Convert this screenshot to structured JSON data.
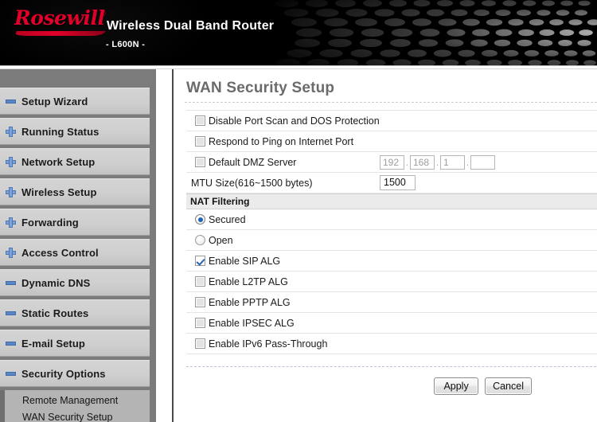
{
  "header": {
    "brand": "Rosewill",
    "registered_mark": "®",
    "product_title": "Wireless Dual Band Router",
    "model": "- L600N -"
  },
  "sidebar": {
    "items": [
      {
        "label": "Setup Wizard",
        "icon": "minus-icon"
      },
      {
        "label": "Running Status",
        "icon": "plus-icon"
      },
      {
        "label": "Network Setup",
        "icon": "plus-icon"
      },
      {
        "label": "Wireless Setup",
        "icon": "plus-icon"
      },
      {
        "label": "Forwarding",
        "icon": "plus-icon"
      },
      {
        "label": "Access Control",
        "icon": "plus-icon"
      },
      {
        "label": "Dynamic DNS",
        "icon": "minus-icon"
      },
      {
        "label": "Static Routes",
        "icon": "minus-icon"
      },
      {
        "label": "E-mail Setup",
        "icon": "minus-icon"
      },
      {
        "label": "Security Options",
        "icon": "minus-icon"
      }
    ],
    "subitems": [
      {
        "label": "Remote Management"
      },
      {
        "label": "WAN Security Setup"
      }
    ]
  },
  "main": {
    "title": "WAN Security Setup",
    "rows": [
      {
        "type": "checkbox",
        "label": "Disable Port Scan and DOS Protection",
        "checked": false
      },
      {
        "type": "checkbox",
        "label": "Respond to Ping on Internet Port",
        "checked": false
      },
      {
        "type": "checkbox-ip",
        "label": "Default DMZ Server",
        "checked": false,
        "ip": [
          "192",
          "168",
          "1",
          ""
        ],
        "separator": "."
      },
      {
        "type": "text",
        "label": "MTU Size(616~1500 bytes)",
        "value": "1500"
      },
      {
        "type": "section",
        "label": "NAT Filtering"
      },
      {
        "type": "radio",
        "label": "Secured",
        "selected": true,
        "group": "nat-filtering"
      },
      {
        "type": "radio",
        "label": "Open",
        "selected": false,
        "group": "nat-filtering"
      },
      {
        "type": "checkbox",
        "label": "Enable SIP ALG",
        "checked": true
      },
      {
        "type": "checkbox",
        "label": "Enable L2TP ALG",
        "checked": false
      },
      {
        "type": "checkbox",
        "label": "Enable PPTP ALG",
        "checked": false
      },
      {
        "type": "checkbox",
        "label": "Enable IPSEC ALG",
        "checked": false
      },
      {
        "type": "checkbox",
        "label": "Enable IPv6 Pass-Through",
        "checked": false
      }
    ],
    "buttons": {
      "apply": "Apply",
      "cancel": "Cancel"
    }
  },
  "colors": {
    "brand_red": "#e0002a",
    "header_black": "#000000",
    "sidebar_gray": "#7b7b7b",
    "nav_item_gray": "#cfcfcf",
    "accent_blue": "#2a63b8",
    "title_gray": "#6b6b6b",
    "section_gray": "#ebebeb"
  }
}
